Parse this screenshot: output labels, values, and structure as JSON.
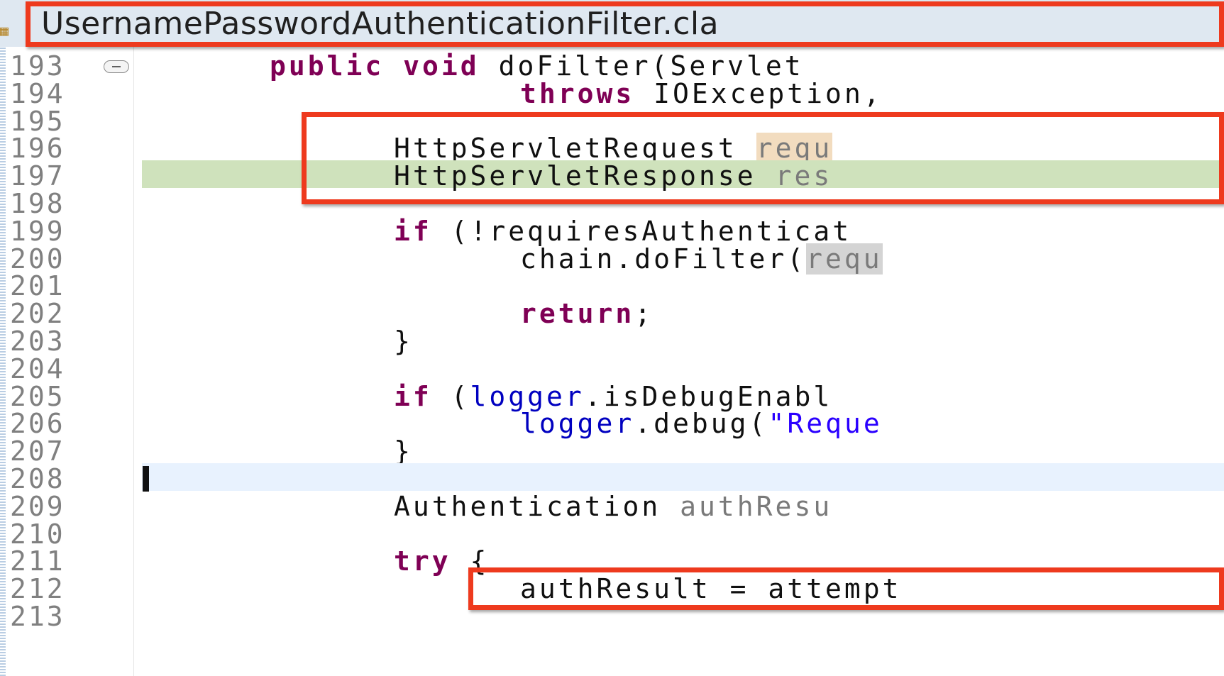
{
  "editor_tab": {
    "title": "UsernamePasswordAuthenticationFilter.cla",
    "icon": "class-file-icon"
  },
  "lines": [
    {
      "num": "193",
      "segments": [
        {
          "t": "public",
          "c": "kw"
        },
        {
          "t": " "
        },
        {
          "t": "void",
          "c": "kw"
        },
        {
          "t": " doFilter(Servlet"
        }
      ]
    },
    {
      "num": "194",
      "segments": [
        {
          "t": "throws",
          "c": "kw"
        },
        {
          "t": " IOException,"
        }
      ]
    },
    {
      "num": "195",
      "segments": []
    },
    {
      "num": "196",
      "segments": [
        {
          "t": "HttpServletRequest "
        },
        {
          "t": "requ",
          "c": "occ-local"
        }
      ]
    },
    {
      "num": "197",
      "segments": [
        {
          "t": "HttpServletResponse "
        },
        {
          "t": "res",
          "c": "var-gray"
        }
      ]
    },
    {
      "num": "198",
      "segments": []
    },
    {
      "num": "199",
      "segments": [
        {
          "t": "if",
          "c": "kw"
        },
        {
          "t": " (!requiresAuthenticat"
        }
      ]
    },
    {
      "num": "200",
      "segments": [
        {
          "t": "chain.doFilter("
        },
        {
          "t": "requ",
          "c": "occ-ref"
        }
      ]
    },
    {
      "num": "201",
      "segments": []
    },
    {
      "num": "202",
      "segments": [
        {
          "t": "return",
          "c": "kw"
        },
        {
          "t": ";"
        }
      ]
    },
    {
      "num": "203",
      "segments": [
        {
          "t": "}"
        }
      ]
    },
    {
      "num": "204",
      "segments": []
    },
    {
      "num": "205",
      "segments": [
        {
          "t": "if",
          "c": "kw"
        },
        {
          "t": " ("
        },
        {
          "t": "logger",
          "c": "fld"
        },
        {
          "t": ".isDebugEnabl"
        }
      ]
    },
    {
      "num": "206",
      "segments": [
        {
          "t": "logger",
          "c": "fld"
        },
        {
          "t": ".debug("
        },
        {
          "t": "\"Reque",
          "c": "str"
        }
      ]
    },
    {
      "num": "207",
      "segments": [
        {
          "t": "}"
        }
      ]
    },
    {
      "num": "208",
      "segments": []
    },
    {
      "num": "209",
      "segments": [
        {
          "t": "Authentication "
        },
        {
          "t": "authResu",
          "c": "var-gray"
        }
      ]
    },
    {
      "num": "210",
      "segments": []
    },
    {
      "num": "211",
      "segments": [
        {
          "t": "try",
          "c": "kw"
        },
        {
          "t": " {"
        }
      ]
    },
    {
      "num": "212",
      "segments": [
        {
          "t": "authResult"
        },
        {
          "t": " = attempt"
        }
      ]
    },
    {
      "num": "213",
      "segments": []
    }
  ],
  "colors": {
    "annotation_box": "#ee3a1e",
    "keyword": "#7f0055",
    "field": "#0000c0",
    "string": "#2a00ff",
    "current_line": "#e8f2fe",
    "debug_line": "#cfe2bc"
  }
}
